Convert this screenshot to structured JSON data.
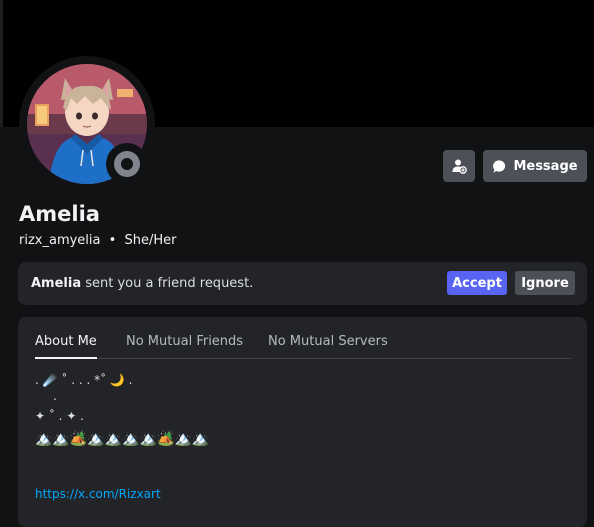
{
  "profile": {
    "display_name": "Amelia",
    "username": "rizx_amyelia",
    "separator": "•",
    "pronouns": "She/Her",
    "status": "offline",
    "avatar_icon": "anime-avatar-icon"
  },
  "actions": {
    "add_friend_icon": "add-friend-icon",
    "message_label": "Message",
    "message_icon": "chat-bubble-icon"
  },
  "friend_request": {
    "name": "Amelia",
    "text": " sent you a friend request.",
    "accept_label": "Accept",
    "ignore_label": "Ignore"
  },
  "tabs": [
    {
      "label": "About Me",
      "active": true
    },
    {
      "label": "No Mutual Friends",
      "active": false
    },
    {
      "label": "No Mutual Servers",
      "active": false
    }
  ],
  "bio": {
    "line1": ".   ☄️ ˚ .    .    .  *˚ 🌙 .",
    "line2": ".",
    "line3": "✦       ˚           .        ✦        .",
    "line4": "🏔️🏔️🏕️🏔️🏔️🏔️🏔️🏕️🏔️🏔️",
    "link": "https://x.com/Rizxart"
  },
  "colors": {
    "accent": "#5865f2",
    "link": "#00a8fc",
    "status_offline": "#80848e"
  }
}
